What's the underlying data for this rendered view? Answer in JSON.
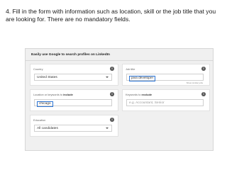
{
  "instruction": "4.   Fill in the form with information such as location, skill or the job title that you are looking for. There are no mandatory fields.",
  "form": {
    "title": "Easily use Google to search profiles on LinkedIn",
    "country": {
      "label": "Country",
      "value": "United States"
    },
    "job_title": {
      "label": "Job title",
      "value": "java developer",
      "hint": "Show similar jobs"
    },
    "location": {
      "label_prefix": "Location or keywords to",
      "label_em": "include",
      "value": "chicago"
    },
    "exclude": {
      "label_prefix": "Keywords to",
      "label_em": "exclude",
      "placeholder": "e.g. Accountant, Senior"
    },
    "education": {
      "label": "Education",
      "value": "All candidates"
    }
  },
  "icons": {
    "info": "info-icon",
    "dropdown": "chevron-down-icon"
  }
}
